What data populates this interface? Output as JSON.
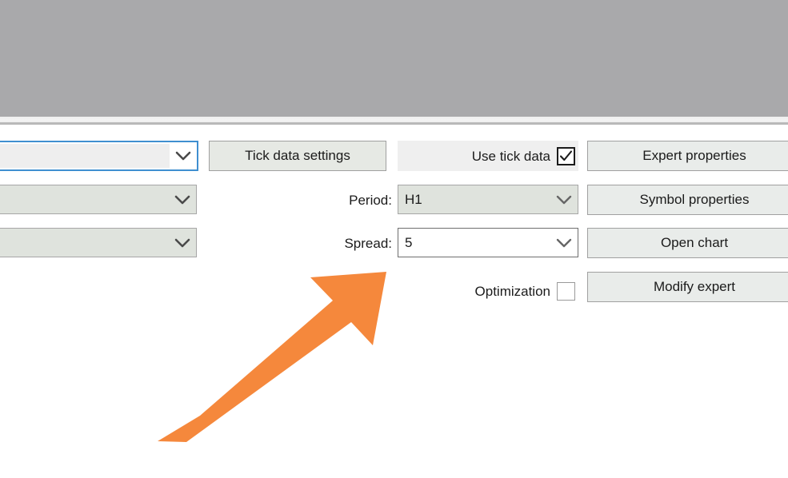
{
  "window": {
    "top_bar_color": "#a9a9ab",
    "panel_background": "#ffffff"
  },
  "settings_panel": {
    "left_combos": [
      {
        "name": "symbol-combo",
        "value": "",
        "state": "focused",
        "icon": "chevron-down-icon"
      },
      {
        "name": "model-combo",
        "value": "",
        "state": "disabled",
        "icon": "chevron-down-icon"
      },
      {
        "name": "date-combo",
        "value": "",
        "state": "disabled",
        "icon": "chevron-down-icon"
      }
    ],
    "tick_data_settings_button": "Tick data settings",
    "use_tick_data": {
      "label": "Use tick data",
      "checked": true,
      "icon": "checkmark-icon"
    },
    "period": {
      "label": "Period:",
      "value": "H1",
      "icon": "chevron-down-icon"
    },
    "spread": {
      "label": "Spread:",
      "value": "5",
      "icon": "chevron-down-icon"
    },
    "optimization": {
      "label": "Optimization",
      "checked": false
    },
    "action_buttons": [
      {
        "name": "expert-properties-button",
        "label": "Expert properties"
      },
      {
        "name": "symbol-properties-button",
        "label": "Symbol properties"
      },
      {
        "name": "open-chart-button",
        "label": "Open chart"
      },
      {
        "name": "modify-expert-button",
        "label": "Modify expert"
      }
    ]
  },
  "annotation": {
    "arrow": {
      "name": "orange-pointer-arrow",
      "color": "#f5883c",
      "points_to": "Spread field"
    }
  },
  "colors": {
    "accent_focus": "#3f8fd0",
    "annotation_orange": "#f5883c",
    "button_face": "#e9ecea",
    "disabled_field": "#dfe3dd",
    "top_chrome": "#a9a9ab"
  }
}
